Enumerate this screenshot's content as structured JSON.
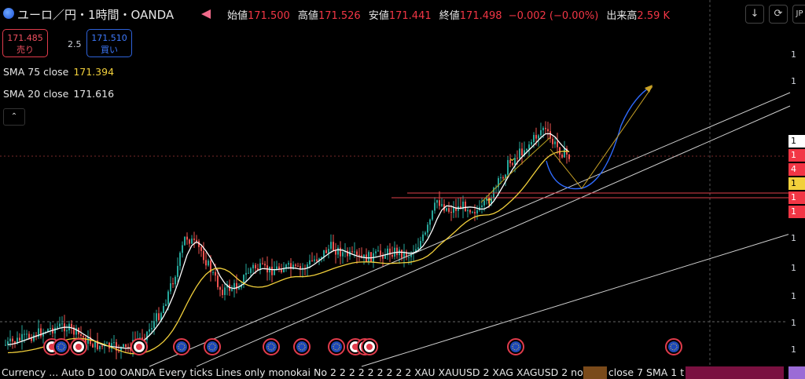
{
  "header": {
    "symbol": "ユーロ／円・1時間・OANDA",
    "open_label": "始値",
    "open": "171.500",
    "high_label": "高値",
    "high": "171.526",
    "low_label": "安値",
    "low": "171.441",
    "close_label": "終値",
    "close": "171.498",
    "change": "−0.002 (−0.00%)",
    "volume_label": "出来高",
    "volume": "2.59 K",
    "buttons": {
      "download": "↓",
      "refresh": "⟳",
      "lang": "JP"
    }
  },
  "trade": {
    "sell_price": "171.485",
    "sell_label": "売り",
    "spread": "2.5",
    "buy_price": "171.510",
    "buy_label": "買い"
  },
  "indicators": {
    "sma75_label": "SMA 75 close",
    "sma75_value": "171.394",
    "sma20_label": "SMA 20 close",
    "sma20_value": "171.616",
    "collapse": "⌃"
  },
  "axis": {
    "labels": [
      {
        "text": "1",
        "bg": "#000",
        "fg": "#d1d4dc"
      },
      {
        "text": "1",
        "bg": "#000",
        "fg": "#d1d4dc"
      },
      {
        "text": "1",
        "bg": "#ffffff",
        "fg": "#000"
      },
      {
        "text": "1",
        "bg": "#f23645",
        "fg": "#fff"
      },
      {
        "text": "4",
        "bg": "#f23645",
        "fg": "#fff"
      },
      {
        "text": "1",
        "bg": "#f2d03b",
        "fg": "#000"
      },
      {
        "text": "1",
        "bg": "#f23645",
        "fg": "#fff"
      },
      {
        "text": "1",
        "bg": "#f23645",
        "fg": "#fff"
      },
      {
        "text": "1",
        "bg": "#000",
        "fg": "#d1d4dc"
      },
      {
        "text": "1",
        "bg": "#000",
        "fg": "#d1d4dc"
      },
      {
        "text": "1",
        "bg": "#000",
        "fg": "#d1d4dc"
      },
      {
        "text": "1",
        "bg": "#000",
        "fg": "#d1d4dc"
      },
      {
        "text": "1",
        "bg": "#000",
        "fg": "#d1d4dc"
      }
    ]
  },
  "status_bar": {
    "text": "Currency ...  Auto D 100 OANDA Every ticks Lines only monokai No 2 2 2 2 2 2 2 2 2 XAU XAUUSD 2 XAG XAGUSD 2 normal close 7 SMA 1 t"
  },
  "colors": {
    "up": "#26a69a",
    "down": "#ef5350",
    "sma20": "#ffffff",
    "sma75": "#f2d03b",
    "trendline": "#cfcfcf",
    "red_level": "#e0404a",
    "blue_path": "#2f6bff",
    "annot": "#c9a227"
  }
}
